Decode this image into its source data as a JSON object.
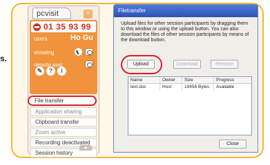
{
  "edge_text": "s.",
  "pcvisit": {
    "title": "pcvisit",
    "close_glyph": "×",
    "id_icon": "stop-sign-icon",
    "id_number": "01 35 93 99",
    "users_label": "users",
    "users_cols": "Ho Gu",
    "rows": [
      {
        "label": "showing",
        "icon_a": "cursor-icon",
        "icon_b": "eye-icon"
      },
      {
        "label": "remote assi",
        "icon_b": "lock-icon"
      }
    ],
    "tools": [
      "wrench-icon",
      "help-icon",
      "info-icon"
    ],
    "tool_glyphs": [
      "✎",
      "?",
      "i"
    ],
    "menu": [
      {
        "label": "File transfer",
        "highlighted": true
      },
      {
        "label": "Application sharing"
      },
      {
        "label": "Clipboard transfer"
      },
      {
        "label": "Zoom active",
        "muted": true
      },
      {
        "label": "Recording deactivated"
      },
      {
        "label": "Session history"
      }
    ]
  },
  "filetransfer": {
    "title": "Filetransfer",
    "description": "Upload files for other session participants by dragging them to this window or using the upload button. You can also download the files of other session participants by means of the download button.",
    "buttons": {
      "upload": "Upload",
      "download": "Download",
      "remove": "Remove",
      "close": "Close"
    },
    "columns": [
      "Name",
      "Owner",
      "Size",
      "Progress"
    ],
    "rows": [
      [
        "text.doc",
        "Host",
        "19456 Bytes",
        "Available"
      ]
    ]
  },
  "colors": {
    "accent_orange": "#f0933c",
    "highlight_red": "#d91e2a",
    "titlebar_blue": "#2b53b8",
    "frame_border": "#f3b43a"
  }
}
